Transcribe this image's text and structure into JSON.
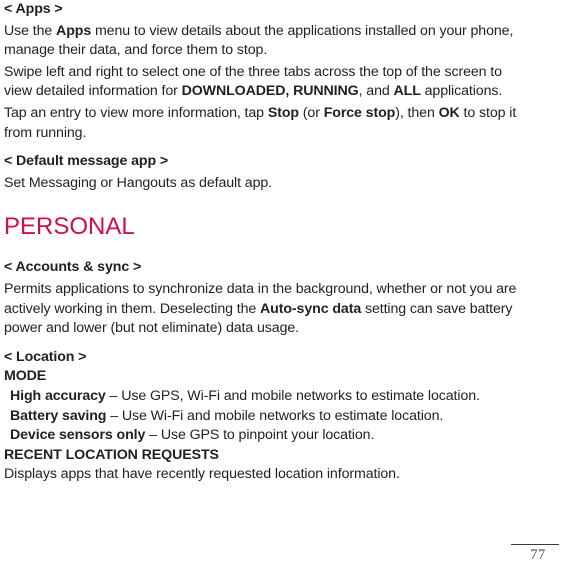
{
  "document": {
    "page_number": "77",
    "accent_color": "#CE0E4E",
    "text_color": "#231f20"
  },
  "sections": [
    {
      "id": "apps",
      "heading": "< Apps >",
      "paragraphs": [
        {
          "id": "apps-p1",
          "runs": [
            {
              "text": "Use the ",
              "bold": false
            },
            {
              "text": "Apps",
              "bold": true
            },
            {
              "text": " menu to view details about the applications installed on your phone, manage their data, and force them to stop.",
              "bold": false
            }
          ]
        },
        {
          "id": "apps-p2",
          "runs": [
            {
              "text": "Swipe left and right to select one of the three tabs across the top of the screen to view detailed information for ",
              "bold": false
            },
            {
              "text": "DOWNLOADED, RUNNING",
              "bold": true
            },
            {
              "text": ", and ",
              "bold": false
            },
            {
              "text": "ALL",
              "bold": true
            },
            {
              "text": " applications.",
              "bold": false
            }
          ]
        },
        {
          "id": "apps-p3",
          "runs": [
            {
              "text": "Tap an entry to view more information, tap ",
              "bold": false
            },
            {
              "text": "Stop",
              "bold": true
            },
            {
              "text": " (or ",
              "bold": false
            },
            {
              "text": "Force stop",
              "bold": true
            },
            {
              "text": "), then ",
              "bold": false
            },
            {
              "text": "OK",
              "bold": true
            },
            {
              "text": " to stop it from running.",
              "bold": false
            }
          ]
        }
      ]
    },
    {
      "id": "default-message-app",
      "heading": "< Default message app >",
      "paragraphs": [
        {
          "id": "dma-p1",
          "runs": [
            {
              "text": "Set Messaging or Hangouts as default app.",
              "bold": false
            }
          ]
        }
      ]
    }
  ],
  "category_heading": "PERSONAL",
  "sections2": [
    {
      "id": "accounts-sync",
      "heading": "< Accounts & sync >",
      "paragraphs": [
        {
          "id": "as-p1",
          "runs": [
            {
              "text": "Permits applications to synchronize data in the background, whether or not you are actively working in them. Deselecting the ",
              "bold": false
            },
            {
              "text": "Auto-sync data",
              "bold": true
            },
            {
              "text": " setting can save battery power and lower (but not eliminate) data usage.",
              "bold": false
            }
          ]
        }
      ]
    }
  ],
  "location": {
    "heading": "< Location >",
    "mode_label": "MODE",
    "modes": [
      {
        "term": "High accuracy",
        "dash": " – ",
        "desc": "Use GPS, Wi-Fi and mobile networks to estimate location."
      },
      {
        "term": "Battery saving",
        "dash": " – ",
        "desc": "Use Wi-Fi and mobile networks to estimate location."
      },
      {
        "term": "Device sensors only",
        "dash": " – ",
        "desc": "Use GPS to pinpoint your location."
      }
    ],
    "recent_label": "RECENT LOCATION REQUESTS",
    "recent_desc": "Displays apps that have recently requested location information."
  }
}
